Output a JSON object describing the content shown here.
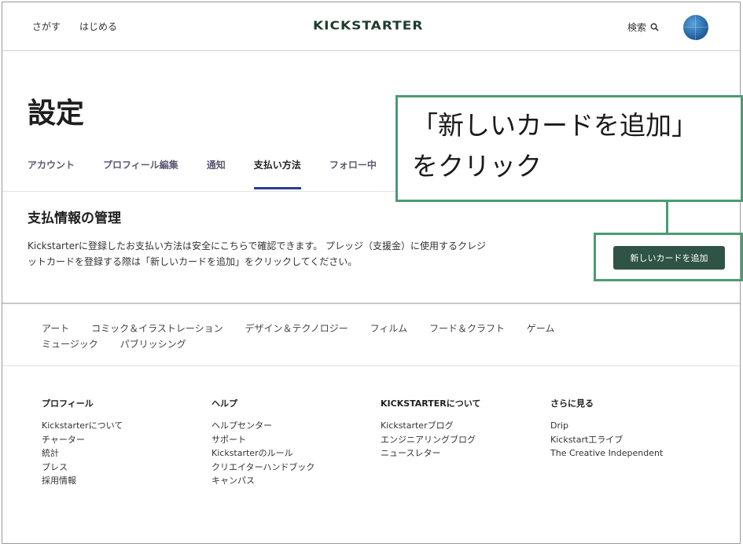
{
  "header": {
    "nav_explore": "さがす",
    "nav_start": "はじめる",
    "logo": "KICKSTARTER",
    "search_label": "検索"
  },
  "page": {
    "title": "設定",
    "tabs": [
      "アカウント",
      "プロフィール編集",
      "通知",
      "支払い方法",
      "フォロー中"
    ],
    "active_tab": "支払い方法"
  },
  "payment": {
    "title": "支払情報の管理",
    "description": "Kickstarterに登録したお支払い方法は安全にこちらで確認できます。 プレッジ（支援金）に使用するクレジットカードを登録する際は「新しいカードを追加」をクリックしてください。",
    "add_card_label": "新しいカードを追加"
  },
  "callout": {
    "line1": "「新しいカードを追加」",
    "line2": "をクリック"
  },
  "categories": [
    "アート",
    "コミック＆イラストレーション",
    "デザイン＆テクノロジー",
    "フィルム",
    "フード＆クラフト",
    "ゲーム",
    "ミュージック",
    "パブリッシング"
  ],
  "footer": {
    "columns": [
      {
        "title": "プロフィール",
        "links": [
          "Kickstarterについて",
          "チャーター",
          "統計",
          "プレス",
          "採用情報"
        ]
      },
      {
        "title": "ヘルプ",
        "links": [
          "ヘルプセンター",
          "サポート",
          "Kickstarterのルール",
          "クリエイターハンドブック",
          "キャンパス"
        ]
      },
      {
        "title": "KICKSTARTERについて",
        "links": [
          "Kickstarterブログ",
          "エンジニアリングブログ",
          "ニュースレター"
        ]
      },
      {
        "title": "さらに見る",
        "links": [
          "Drip",
          "Kickstart工ライブ",
          "The Creative Independent"
        ]
      }
    ]
  },
  "colors": {
    "accent_green": "#4b9b72",
    "button_bg": "#2f5445",
    "tab_underline": "#2e3d8f"
  }
}
